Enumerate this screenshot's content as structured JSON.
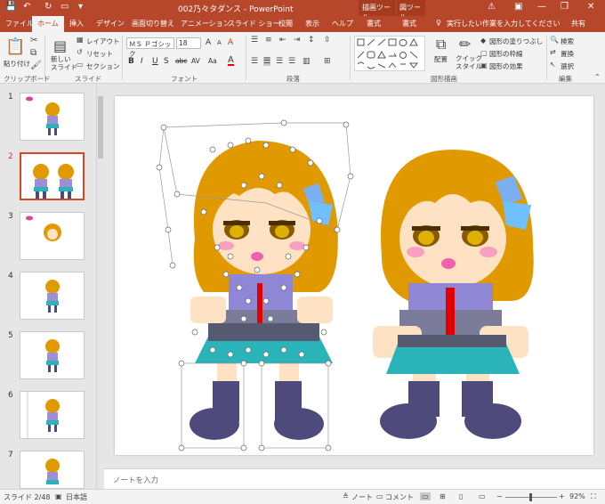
{
  "titlebar": {
    "title": "002乃々タダンス - PowerPoint",
    "context_group_1": "描画ツール",
    "context_group_2": "図ツール",
    "minimize": "—",
    "restore": "❐",
    "close": "✕"
  },
  "tabs": [
    {
      "label": "ファイル"
    },
    {
      "label": "ホーム"
    },
    {
      "label": "挿入"
    },
    {
      "label": "デザイン"
    },
    {
      "label": "画面切り替え"
    },
    {
      "label": "アニメーション"
    },
    {
      "label": "スライド ショー"
    },
    {
      "label": "校閲"
    },
    {
      "label": "表示"
    },
    {
      "label": "ヘルプ"
    },
    {
      "label": "書式"
    },
    {
      "label": "書式"
    }
  ],
  "search": {
    "placeholder": "実行したい作業を入力してください"
  },
  "share": {
    "label": "共有"
  },
  "ribbon": {
    "clipboard": {
      "paste": "貼り付け",
      "label": "クリップボード"
    },
    "slides": {
      "new_slide": "新しい\nスライド",
      "layout": "レイアウト",
      "reset": "リセット",
      "section": "セクション",
      "label": "スライド"
    },
    "font": {
      "font_name": "ＭＳ Ｐゴシック",
      "font_size": "18",
      "label": "フォント",
      "bold": "B",
      "italic": "I",
      "underline": "U",
      "shadow": "S",
      "strike": "abc",
      "spacing": "AV",
      "case": "Aa",
      "grow": "A",
      "shrink": "A",
      "color": "A",
      "clear": "A"
    },
    "paragraph": {
      "label": "段落"
    },
    "drawing": {
      "label": "図形描画",
      "arrange": "配置",
      "quick_styles": "クイック\nスタイル",
      "fill": "図形の塗りつぶし",
      "outline": "図形の枠線",
      "effects": "図形の効果"
    },
    "editing": {
      "label": "編集",
      "find": "検索",
      "replace": "置換",
      "select": "選択"
    }
  },
  "slides": [
    {
      "number": "1"
    },
    {
      "number": "2"
    },
    {
      "number": "3"
    },
    {
      "number": "4"
    },
    {
      "number": "5"
    },
    {
      "number": "6"
    },
    {
      "number": "7"
    }
  ],
  "current_slide": 2,
  "notes": {
    "placeholder": "ノートを入力"
  },
  "status": {
    "slide_info": "スライド 2/48",
    "language": "日本語",
    "notes_btn": "ノート",
    "comments_btn": "コメント",
    "zoom": "92%"
  },
  "colors": {
    "accent": "#b7472a",
    "hair": "#e09a00",
    "skirt_teal": "#2ab3b8",
    "socks": "#4f4a7c",
    "tie": "#e00000",
    "skin": "#ffe1c4"
  }
}
